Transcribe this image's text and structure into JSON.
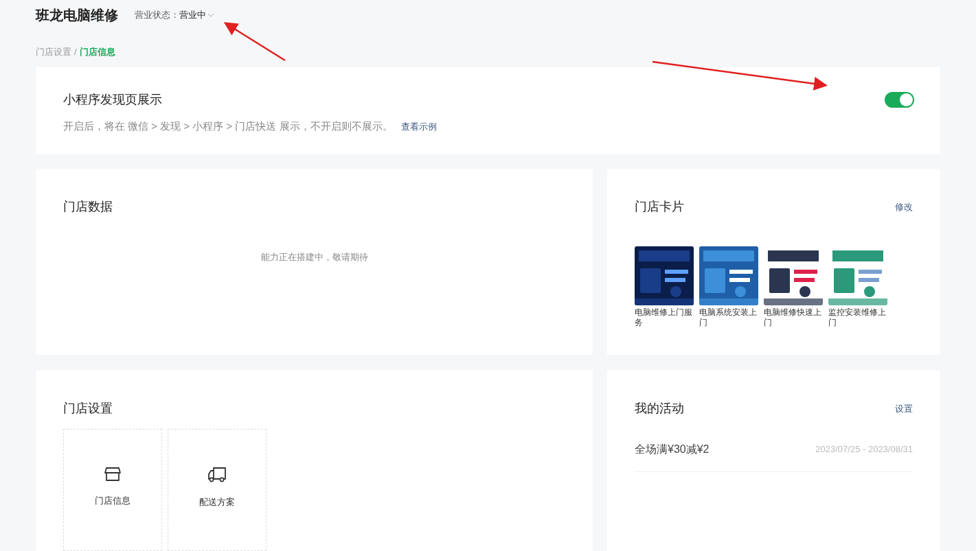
{
  "header": {
    "title": "班龙电脑维修",
    "status_label": "营业状态：",
    "status_value": "营业中"
  },
  "breadcrumb_separator": "/",
  "breadcrumb": [
    {
      "label": "门店设置",
      "selected": false
    },
    {
      "label": "门店信息",
      "selected": true
    }
  ],
  "discover": {
    "title": "小程序发现页展示",
    "description": "开启后，将在 微信 > 发现 > 小程序 > 门店快送 展示，不开启则不展示。",
    "link": "查看示例",
    "on": true
  },
  "store_data": {
    "title": "门店数据",
    "empty_text": "能力正在搭建中，敬请期待"
  },
  "store_card": {
    "title": "门店卡片",
    "action": "修改",
    "items": [
      {
        "caption": "电脑维修上门服务",
        "kind": "picture"
      },
      {
        "caption": "电脑系统安装上门",
        "kind": "picture"
      },
      {
        "caption": "电脑维修快速上门",
        "kind": "picture"
      },
      {
        "caption": "监控安装维修上门",
        "kind": "picture"
      }
    ]
  },
  "store_settings": {
    "title": "门店设置",
    "tiles": [
      {
        "label": "门店信息",
        "kind": "store"
      },
      {
        "label": "配送方案",
        "kind": "truck"
      }
    ]
  },
  "activities": {
    "title": "我的活动",
    "action": "设置",
    "items": [
      {
        "name": "全场满¥30减¥2",
        "dates": "2023/07/25 - 2023/08/31"
      }
    ]
  }
}
